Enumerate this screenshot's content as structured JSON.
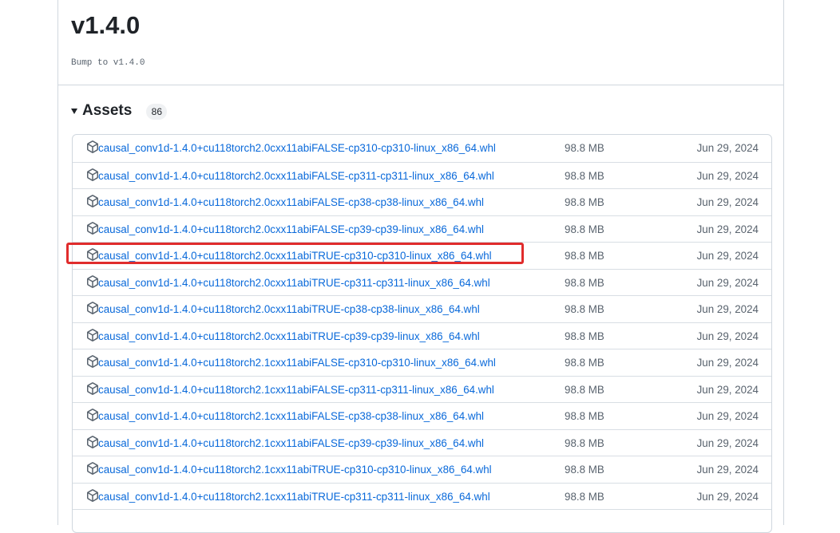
{
  "release": {
    "version": "v1.4.0",
    "notes": "Bump to v1.4.0"
  },
  "assets": {
    "title": "Assets",
    "count": "86",
    "items": [
      {
        "name": "causal_conv1d-1.4.0+cu118torch2.0cxx11abiFALSE-cp310-cp310-linux_x86_64.whl",
        "size": "98.8 MB",
        "date": "Jun 29, 2024"
      },
      {
        "name": "causal_conv1d-1.4.0+cu118torch2.0cxx11abiFALSE-cp311-cp311-linux_x86_64.whl",
        "size": "98.8 MB",
        "date": "Jun 29, 2024"
      },
      {
        "name": "causal_conv1d-1.4.0+cu118torch2.0cxx11abiFALSE-cp38-cp38-linux_x86_64.whl",
        "size": "98.8 MB",
        "date": "Jun 29, 2024"
      },
      {
        "name": "causal_conv1d-1.4.0+cu118torch2.0cxx11abiFALSE-cp39-cp39-linux_x86_64.whl",
        "size": "98.8 MB",
        "date": "Jun 29, 2024"
      },
      {
        "name": "causal_conv1d-1.4.0+cu118torch2.0cxx11abiTRUE-cp310-cp310-linux_x86_64.whl",
        "size": "98.8 MB",
        "date": "Jun 29, 2024",
        "highlighted": true
      },
      {
        "name": "causal_conv1d-1.4.0+cu118torch2.0cxx11abiTRUE-cp311-cp311-linux_x86_64.whl",
        "size": "98.8 MB",
        "date": "Jun 29, 2024"
      },
      {
        "name": "causal_conv1d-1.4.0+cu118torch2.0cxx11abiTRUE-cp38-cp38-linux_x86_64.whl",
        "size": "98.8 MB",
        "date": "Jun 29, 2024"
      },
      {
        "name": "causal_conv1d-1.4.0+cu118torch2.0cxx11abiTRUE-cp39-cp39-linux_x86_64.whl",
        "size": "98.8 MB",
        "date": "Jun 29, 2024"
      },
      {
        "name": "causal_conv1d-1.4.0+cu118torch2.1cxx11abiFALSE-cp310-cp310-linux_x86_64.whl",
        "size": "98.8 MB",
        "date": "Jun 29, 2024"
      },
      {
        "name": "causal_conv1d-1.4.0+cu118torch2.1cxx11abiFALSE-cp311-cp311-linux_x86_64.whl",
        "size": "98.8 MB",
        "date": "Jun 29, 2024"
      },
      {
        "name": "causal_conv1d-1.4.0+cu118torch2.1cxx11abiFALSE-cp38-cp38-linux_x86_64.whl",
        "size": "98.8 MB",
        "date": "Jun 29, 2024"
      },
      {
        "name": "causal_conv1d-1.4.0+cu118torch2.1cxx11abiFALSE-cp39-cp39-linux_x86_64.whl",
        "size": "98.8 MB",
        "date": "Jun 29, 2024"
      },
      {
        "name": "causal_conv1d-1.4.0+cu118torch2.1cxx11abiTRUE-cp310-cp310-linux_x86_64.whl",
        "size": "98.8 MB",
        "date": "Jun 29, 2024"
      },
      {
        "name": "causal_conv1d-1.4.0+cu118torch2.1cxx11abiTRUE-cp311-cp311-linux_x86_64.whl",
        "size": "98.8 MB",
        "date": "Jun 29, 2024"
      },
      {
        "name": "",
        "size": "",
        "date": ""
      }
    ]
  },
  "icons": {
    "asset": "package-icon",
    "toggle": "triangle-down-icon"
  },
  "colors": {
    "link": "#0969da",
    "muted": "#59636e",
    "border": "#d0d7de",
    "highlight": "#e02c2c"
  }
}
